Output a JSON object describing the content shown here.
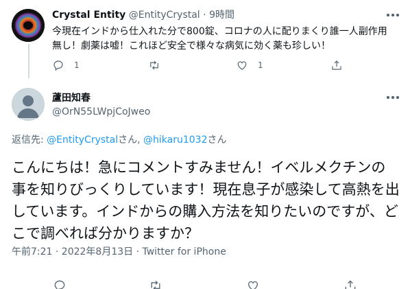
{
  "parent_tweet": {
    "display_name": "Crystal Entity",
    "handle": "@EntityCrystal",
    "separator": "·",
    "time": "9時間",
    "text": "今現在インドから仕入れた分で800錠、コロナの人に配りまくり誰一人副作用無し！劇薬は嘘！これほど安全で様々な病気に効く薬も珍しい！",
    "reply_count": "1",
    "like_count": "1",
    "icons": [
      "reply-icon",
      "retweet-icon",
      "like-icon",
      "share-icon",
      "more-icon"
    ]
  },
  "main_tweet": {
    "display_name": "蘆田知春",
    "handle": "@OrN55LWpjCoJweo",
    "reply_prefix": "返信先: ",
    "reply_user1": "@EntityCrystal",
    "reply_san1": "さん, ",
    "reply_user2": "@hikaru1032",
    "reply_san2": "さん",
    "text": "こんにちは！急にコメントすみません！イベルメクチンの事を知りびっくりしています！現在息子が感染して高熱を出しています。インドからの購入方法を知りたいのですが、どこで調べれば分かりますか？",
    "meta": "午前7:21 · 2022年8月13日 · Twitter for iPhone",
    "icons": [
      "reply-icon",
      "retweet-icon",
      "like-icon",
      "share-icon",
      "more-icon"
    ]
  },
  "colors": {
    "link": "#1d9bf0",
    "secondary": "#536471",
    "thread_line": "#cfd9de"
  }
}
